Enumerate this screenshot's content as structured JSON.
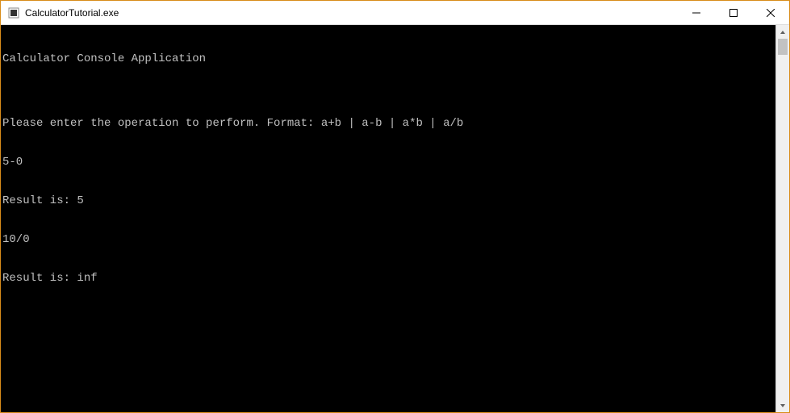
{
  "window": {
    "title": "CalculatorTutorial.exe"
  },
  "console": {
    "lines": [
      "Calculator Console Application",
      "",
      "Please enter the operation to perform. Format: a+b | a-b | a*b | a/b",
      "5-0",
      "Result is: 5",
      "10/0",
      "Result is: inf"
    ]
  }
}
